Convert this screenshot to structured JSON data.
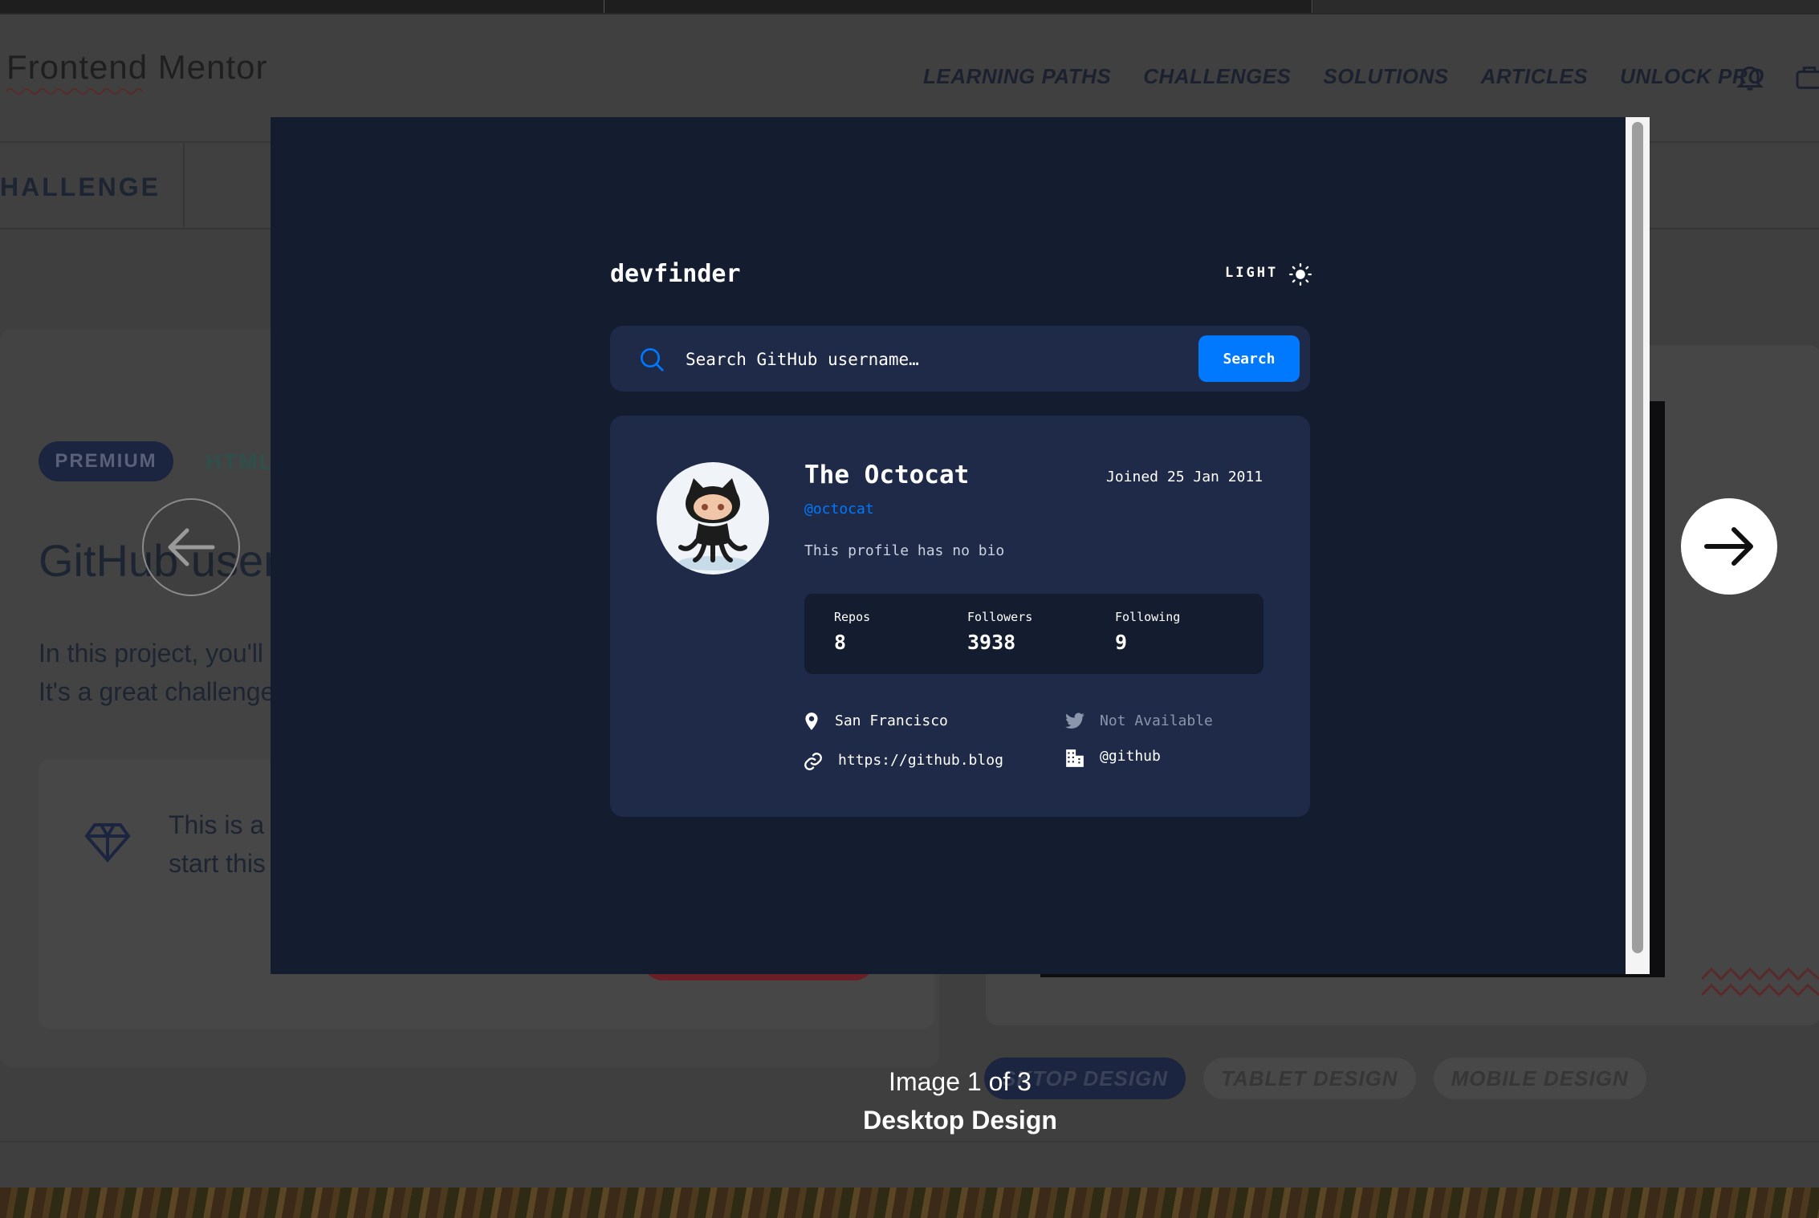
{
  "background_page": {
    "logo": "Frontend Mentor",
    "nav": [
      "LEARNING PATHS",
      "CHALLENGES",
      "SOLUTIONS",
      "ARTICLES",
      "UNLOCK PRO"
    ],
    "subbar_title": "HALLENGE",
    "premium_label": "PREMIUM",
    "html_tag": "HTML",
    "title": "GitHub user",
    "paragraph_lines": [
      "In this project, you'll",
      "It's a great challenge"
    ],
    "info_lines": [
      "This is a",
      "start this"
    ],
    "design_tabs": [
      "SKTOP DESIGN",
      "TABLET DESIGN",
      "MOBILE DESIGN"
    ]
  },
  "devfinder": {
    "app_title": "devfinder",
    "mode_label": "LIGHT",
    "search_placeholder": "Search GitHub username…",
    "search_button": "Search",
    "profile": {
      "name": "The Octocat",
      "joined": "Joined 25 Jan 2011",
      "handle": "@octocat",
      "bio": "This profile has no bio",
      "stats": [
        {
          "label": "Repos",
          "value": "8"
        },
        {
          "label": "Followers",
          "value": "3938"
        },
        {
          "label": "Following",
          "value": "9"
        }
      ],
      "location": "San Francisco",
      "blog": "https://github.blog",
      "twitter": "Not Available",
      "company": "@github"
    }
  },
  "lightbox": {
    "counter": "Image 1 of 3",
    "caption": "Desktop Design"
  },
  "colors": {
    "modal_bg": "#141d2f",
    "card_bg": "#1e2a47",
    "accent": "#0079ff"
  },
  "icons": [
    "bell-icon",
    "cart-icon",
    "diamond-icon",
    "sun-icon",
    "search-icon",
    "location-icon",
    "link-icon",
    "twitter-icon",
    "company-icon",
    "arrow-left-icon",
    "arrow-right-icon"
  ]
}
